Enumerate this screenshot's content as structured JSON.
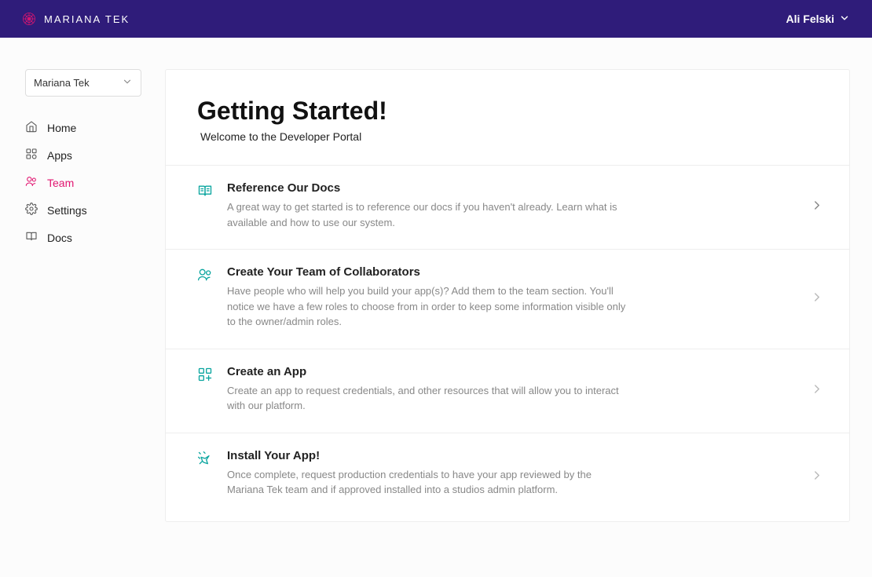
{
  "header": {
    "brand": "MARIANA TEK",
    "user": "Ali Felski"
  },
  "sidebar": {
    "org_selected": "Mariana Tek",
    "items": [
      {
        "label": "Home",
        "icon": "home-icon",
        "active": false
      },
      {
        "label": "Apps",
        "icon": "apps-icon",
        "active": false
      },
      {
        "label": "Team",
        "icon": "team-icon",
        "active": true
      },
      {
        "label": "Settings",
        "icon": "gear-icon",
        "active": false
      },
      {
        "label": "Docs",
        "icon": "book-icon",
        "active": false
      }
    ]
  },
  "main": {
    "title": "Getting Started!",
    "subtitle": "Welcome to the Developer Portal",
    "cards": [
      {
        "icon": "docs-card-icon",
        "title": "Reference Our Docs",
        "desc": "A great way to get started is to reference our docs if you haven't already. Learn what is available and how to use our system."
      },
      {
        "icon": "team-card-icon",
        "title": "Create Your Team of Collaborators",
        "desc": "Have people who will help you build your app(s)? Add them to the team section. You'll notice we have a few roles to choose from in order to keep some information visible only to the owner/admin roles."
      },
      {
        "icon": "app-card-icon",
        "title": "Create an App",
        "desc": "Create an app to request credentials, and other resources that will allow you to interact with our platform."
      },
      {
        "icon": "install-card-icon",
        "title": "Install Your App!",
        "desc": "Once complete, request production credentials to have your app reviewed by the Mariana Tek team and if approved installed into a studios admin platform."
      }
    ]
  },
  "colors": {
    "header_bg": "#2f1c7a",
    "accent_pink": "#e11570",
    "accent_teal": "#0aa59f"
  }
}
